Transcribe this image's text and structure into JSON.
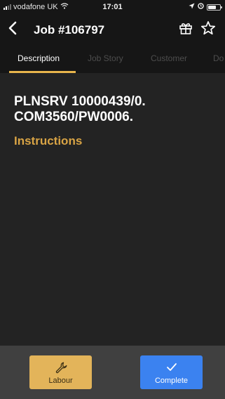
{
  "status_bar": {
    "carrier": "vodafone UK",
    "time": "17:01",
    "battery_level": 0.7
  },
  "header": {
    "title": "Job #106797",
    "back_icon": "chevron-left-icon",
    "gift_icon": "gift-icon",
    "favorite_icon": "star-outline-icon"
  },
  "tabs": [
    {
      "label": "Description",
      "active": true
    },
    {
      "label": "Job Story",
      "active": false
    },
    {
      "label": "Customer",
      "active": false
    },
    {
      "label": "Do",
      "active": false
    }
  ],
  "content": {
    "reference": "PLNSRV 10000439/0. COM3560/PW0006.",
    "instructions_heading": "Instructions"
  },
  "actions": {
    "labour_label": "Labour",
    "labour_icon": "wrench-icon",
    "complete_label": "Complete",
    "complete_icon": "checkmark-icon"
  },
  "colors": {
    "accent": "#e8b54c",
    "instructions": "#d9a445",
    "labour_button": "#e3b45a",
    "complete_button": "#3b82f0"
  }
}
